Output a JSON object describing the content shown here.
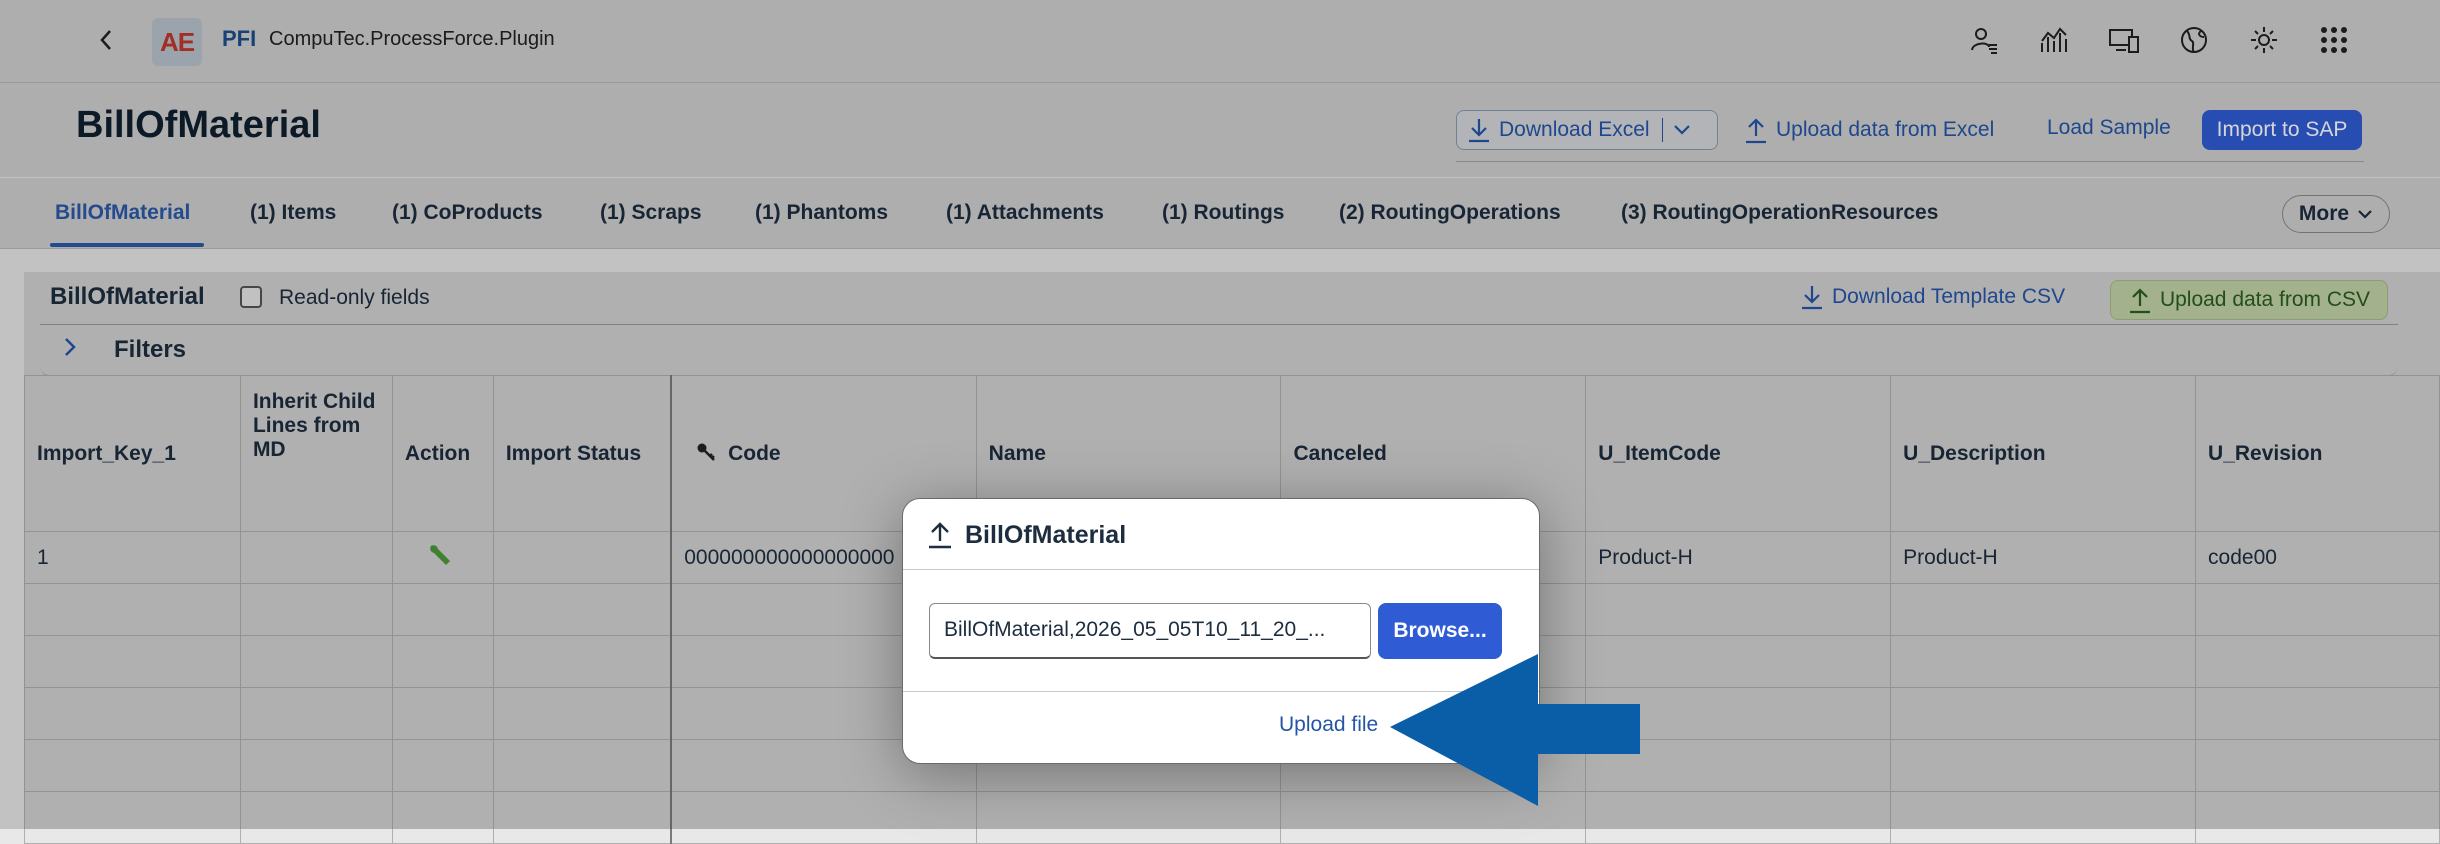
{
  "shell": {
    "logo_text": "AE",
    "brand": "PFI",
    "plugin": "CompuTec.ProcessForce.Plugin",
    "icons": [
      "back-icon",
      "user-settings-icon",
      "analytics-icon",
      "devices-icon",
      "globe-icon",
      "brightness-icon",
      "apps-grid-icon"
    ]
  },
  "header": {
    "title": "BillOfMaterial",
    "download_excel": "Download Excel",
    "upload_excel": "Upload data from Excel",
    "load_sample": "Load Sample",
    "import_sap": "Import to SAP"
  },
  "tabs": [
    {
      "label": "BillOfMaterial",
      "active": true
    },
    {
      "label": "(1) Items"
    },
    {
      "label": "(1) CoProducts"
    },
    {
      "label": "(1) Scraps"
    },
    {
      "label": "(1) Phantoms"
    },
    {
      "label": "(1) Attachments"
    },
    {
      "label": "(1) Routings"
    },
    {
      "label": "(2) RoutingOperations"
    },
    {
      "label": "(3) RoutingOperationResources"
    }
  ],
  "more_label": "More",
  "toolbar": {
    "title": "BillOfMaterial",
    "readonly_label": "Read-only fields",
    "readonly_checked": false,
    "download_template": "Download Template CSV",
    "upload_csv": "Upload data from CSV"
  },
  "filters": {
    "label": "Filters"
  },
  "table": {
    "columns": [
      "Import_Key_1",
      "Inherit Child Lines from MD",
      "Action",
      "Import Status",
      "Code",
      "Name",
      "Canceled",
      "U_ItemCode",
      "U_Description",
      "U_Revision"
    ],
    "rows": [
      [
        "1",
        "",
        "",
        "",
        "000000000000000000",
        "",
        "",
        "Product-H",
        "Product-H",
        "code00"
      ]
    ]
  },
  "dialog": {
    "title": "BillOfMaterial",
    "file_value": "BillOfMaterial,2026_05_05T10_11_20_...",
    "browse": "Browse...",
    "upload": "Upload file"
  },
  "colors": {
    "accent": "#2f5cd4",
    "link": "#2455a8",
    "arrow": "#0a5ea8",
    "csv_button": "#c3d3a8"
  }
}
